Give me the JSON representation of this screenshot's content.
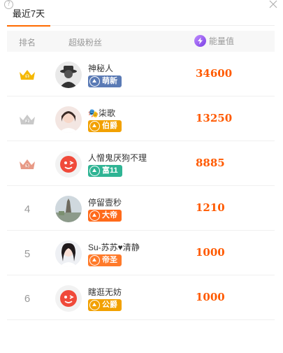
{
  "tabs": {
    "active": "最近7天"
  },
  "table_header": {
    "rank": "排名",
    "fans": "超级粉丝",
    "energy": "能量值"
  },
  "colors": {
    "accent": "#ff6a00",
    "energy_text": "#ff5a00",
    "gold": "#f5b800",
    "silver": "#c9c9c9",
    "bronze": "#e89a86"
  },
  "rows": [
    {
      "rank": "1",
      "rank_icon": "gold-crown-icon",
      "name": "神秘人",
      "badge": "萌新",
      "badge_color": "#5a7ab5",
      "energy": "34600"
    },
    {
      "rank": "2",
      "rank_icon": "silver-crown-icon",
      "name": "🎭柒歌",
      "badge": "伯爵",
      "badge_color": "#f2a100",
      "energy": "13250"
    },
    {
      "rank": "3",
      "rank_icon": "bronze-crown-icon",
      "name": "人憎鬼厌狗不理",
      "badge": "富11",
      "badge_color": "#2fb494",
      "energy": "8885"
    },
    {
      "rank": "4",
      "name": "停留壹秒",
      "badge": "大帝",
      "badge_color": "#ff6a1a",
      "energy": "1210"
    },
    {
      "rank": "5",
      "name": "Su-苏苏♥清静",
      "badge": "帝圣",
      "badge_color": "#ff7a2a",
      "energy": "1000"
    },
    {
      "rank": "6",
      "name": "瞎逛无妨",
      "badge": "公爵",
      "badge_color": "#f2a100",
      "energy": "1000"
    }
  ]
}
